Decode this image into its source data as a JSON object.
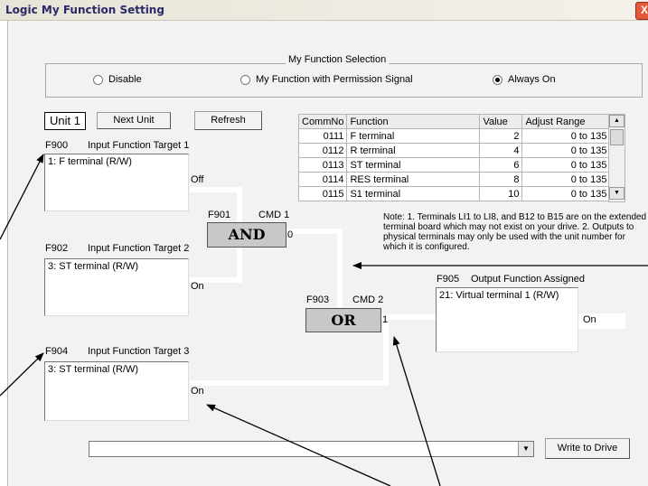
{
  "window": {
    "title": "Logic My Function Setting",
    "close_glyph": "X"
  },
  "selection": {
    "legend": "My Function Selection",
    "options": [
      {
        "label": "Disable",
        "selected": false
      },
      {
        "label": "My Function with Permission Signal",
        "selected": false
      },
      {
        "label": "Always On",
        "selected": true
      }
    ]
  },
  "controls": {
    "unit": "Unit 1",
    "next_unit": "Next Unit",
    "refresh": "Refresh",
    "write": "Write to Drive",
    "combo_value": ""
  },
  "inputs": [
    {
      "code": "F900",
      "label": "Input Function Target 1",
      "value": "1: F terminal (R/W)",
      "state": "Off"
    },
    {
      "code": "F902",
      "label": "Input Function Target 2",
      "value": "3: ST terminal (R/W)",
      "state": "On"
    },
    {
      "code": "F904",
      "label": "Input Function Target 3",
      "value": "3: ST terminal (R/W)",
      "state": "On"
    }
  ],
  "gate1": {
    "code": "F901",
    "cmd": "CMD 1",
    "op": "AND",
    "out": "0"
  },
  "gate2": {
    "code": "F903",
    "cmd": "CMD 2",
    "op": "OR",
    "out": "1"
  },
  "output": {
    "code": "F905",
    "label": "Output Function Assigned",
    "value": "21: Virtual terminal 1 (R/W)",
    "state": "On"
  },
  "table": {
    "headers": [
      "CommNo",
      "Function",
      "Value",
      "Adjust Range"
    ],
    "rows": [
      [
        "0111",
        "F terminal",
        "2",
        "0 to 135"
      ],
      [
        "0112",
        "R terminal",
        "4",
        "0 to 135"
      ],
      [
        "0113",
        "ST terminal",
        "6",
        "0 to 135"
      ],
      [
        "0114",
        "RES terminal",
        "8",
        "0 to 135"
      ],
      [
        "0115",
        "S1 terminal",
        "10",
        "0 to 135"
      ]
    ]
  },
  "note": "Note: 1. Terminals LI1 to LI8, and B12 to B15 are on the extended terminal board which may not exist on your drive. 2. Outputs to physical terminals may only be used with the unit number for which it is configured."
}
